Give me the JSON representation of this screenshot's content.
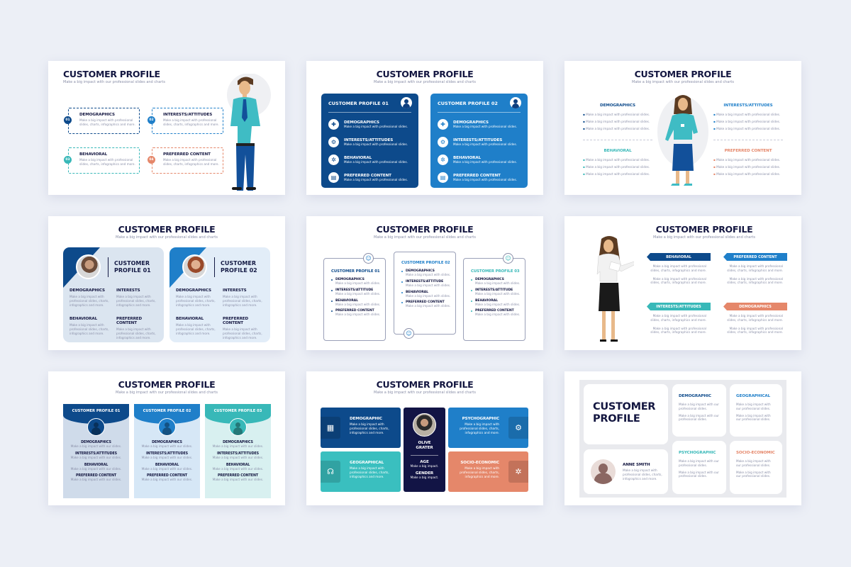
{
  "common": {
    "title": "CUSTOMER PROFILE",
    "subtitle": "Make a big impact with our professional slides and charts"
  },
  "colors": {
    "navy": "#0d4a8b",
    "blue": "#1f7fc9",
    "teal": "#38b8b8",
    "coral": "#e5876a",
    "dark": "#141a44",
    "background": "#eceff6"
  },
  "slide1": {
    "items": [
      {
        "num": "01",
        "heading": "DEMOGRAPHICS",
        "text": "Make a big impact with professional slides, charts, infographics and more."
      },
      {
        "num": "02",
        "heading": "INTERESTS/ATTITUDES",
        "text": "Make a big impact with professional slides, charts, infographics and more."
      },
      {
        "num": "03",
        "heading": "BEHAVIORAL",
        "text": "Make a big impact with professional slides, charts, infographics and more."
      },
      {
        "num": "04",
        "heading": "PREFERRED CONTENT",
        "text": "Make a big impact with professional slides, charts, infographics and more."
      }
    ]
  },
  "slide2": {
    "cards": [
      {
        "title": "CUSTOMER PROFILE 01",
        "rows": [
          {
            "heading": "DEMOGRAPHICS",
            "text": "Make a big impact with professional slides."
          },
          {
            "heading": "INTERESTS/ATTITUDES",
            "text": "Make a big impact with professional slides."
          },
          {
            "heading": "BEHAVIORAL",
            "text": "Make a big impact with professional slides."
          },
          {
            "heading": "PREFERRED CONTENT",
            "text": "Make a big impact with professional slides."
          }
        ]
      },
      {
        "title": "CUSTOMER PROFILE 02",
        "rows": [
          {
            "heading": "DEMOGRAPHICS",
            "text": "Make a big impact with professional slides."
          },
          {
            "heading": "INTERESTS/ATTITUDES",
            "text": "Make a big impact with professional slides."
          },
          {
            "heading": "BEHAVIORAL",
            "text": "Make a big impact with professional slides."
          },
          {
            "heading": "PREFERRED CONTENT",
            "text": "Make a big impact with professional slides."
          }
        ]
      }
    ]
  },
  "slide3": {
    "sections": [
      {
        "heading": "DEMOGRAPHICS",
        "bullets": [
          "Make a big impact with professional slides.",
          "Make a big impact with professional slides.",
          "Make a big impact with professional slides."
        ]
      },
      {
        "heading": "INTERESTS/ATTITUDES",
        "bullets": [
          "Make a big impact with professional slides.",
          "Make a big impact with professional slides.",
          "Make a big impact with professional slides."
        ]
      },
      {
        "heading": "BEHAVIORAL",
        "bullets": [
          "Make a big impact with professional slides.",
          "Make a big impact with professional slides.",
          "Make a big impact with professional slides."
        ]
      },
      {
        "heading": "PREFERRED CONTENT",
        "bullets": [
          "Make a big impact with professional slides.",
          "Make a big impact with professional slides.",
          "Make a big impact with professional slides."
        ]
      }
    ]
  },
  "slide4": {
    "cards": [
      {
        "title_line1": "CUSTOMER",
        "title_line2": "PROFILE 01",
        "cells": [
          {
            "heading": "DEMOGRAPHICS",
            "text": "Make a big impact with professional slides, charts, infographics and more."
          },
          {
            "heading": "INTERESTS",
            "text": "Make a big impact with professional slides, charts, infographics and more."
          },
          {
            "heading": "BEHAVIORAL",
            "text": "Make a big impact with professional slides, charts, infographics and more."
          },
          {
            "heading": "PREFERRED CONTENT",
            "text": "Make a big impact with professional slides, charts, infographics and more."
          }
        ]
      },
      {
        "title_line1": "CUSTOMER",
        "title_line2": "PROFILE 02",
        "cells": [
          {
            "heading": "DEMOGRAPHICS",
            "text": "Make a big impact with professional slides, charts, infographics and more."
          },
          {
            "heading": "INTERESTS",
            "text": "Make a big impact with professional slides, charts, infographics and more."
          },
          {
            "heading": "BEHAVIORAL",
            "text": "Make a big impact with professional slides, charts, infographics and more."
          },
          {
            "heading": "PREFERRED CONTENT",
            "text": "Make a big impact with professional slides, charts, infographics and more."
          }
        ]
      }
    ]
  },
  "slide5": {
    "cards": [
      {
        "title": "CUSTOMER PROFILE 01",
        "items": [
          {
            "heading": "DEMOGRAPHICS",
            "text": "Make a big impact with slides."
          },
          {
            "heading": "INTERESTS/ATTITUDE",
            "text": "Make a big impact with slides."
          },
          {
            "heading": "BEHAVIORAL",
            "text": "Make a big impact with slides."
          },
          {
            "heading": "PREFERRED CONTENT",
            "text": "Make a big impact with slides."
          }
        ]
      },
      {
        "title": "CUSTOMER PROFILE 02",
        "items": [
          {
            "heading": "DEMOGRAPHICS",
            "text": "Make a big impact with slides."
          },
          {
            "heading": "INTERESTS/ATTITUDE",
            "text": "Make a big impact with slides."
          },
          {
            "heading": "BEHAVIORAL",
            "text": "Make a big impact with slides."
          },
          {
            "heading": "PREFERRED CONTENT",
            "text": "Make a big impact with slides."
          }
        ]
      },
      {
        "title": "CUSTOMER PROFILE 03",
        "items": [
          {
            "heading": "DEMOGRAPHICS",
            "text": "Make a big impact with slides."
          },
          {
            "heading": "INTERESTS/ATTITUDE",
            "text": "Make a big impact with slides."
          },
          {
            "heading": "BEHAVIORAL",
            "text": "Make a big impact with slides."
          },
          {
            "heading": "PREFERRED CONTENT",
            "text": "Make a big impact with slides."
          }
        ]
      }
    ]
  },
  "slide6": {
    "sections": [
      {
        "heading": "BEHAVIORAL",
        "paras": [
          "Make a big impact with professional slides, charts, infographics and more.",
          "Make a big impact with professional slides, charts, infographics and more."
        ]
      },
      {
        "heading": "PREFERRED CONTENT",
        "paras": [
          "Make a big impact with professional slides, charts, infographics and more.",
          "Make a big impact with professional slides, charts, infographics and more."
        ]
      },
      {
        "heading": "INTERESTS/ATTITUDES",
        "paras": [
          "Make a big impact with professional slides, charts, infographics and more.",
          "Make a big impact with professional slides, charts, infographics and more."
        ]
      },
      {
        "heading": "DEMOGRAPHICS",
        "paras": [
          "Make a big impact with professional slides, charts, infographics and more.",
          "Make a big impact with professional slides, charts, infographics and more."
        ]
      }
    ]
  },
  "slide7": {
    "columns": [
      {
        "title": "CUSTOMER PROFILE 01",
        "items": [
          {
            "heading": "DEMOGRAPHICS",
            "text": "Make a big impact with our slides."
          },
          {
            "heading": "INTERESTS/ATTITUDES",
            "text": "Make a big impact with our slides."
          },
          {
            "heading": "BEHAVIORAL",
            "text": "Make a big impact with our slides."
          },
          {
            "heading": "PREFERRED CONTENT",
            "text": "Make a big impact with our slides."
          }
        ]
      },
      {
        "title": "CUSTOMER PROFILE 02",
        "items": [
          {
            "heading": "DEMOGRAPHICS",
            "text": "Make a big impact with our slides."
          },
          {
            "heading": "INTERESTS/ATTITUDES",
            "text": "Make a big impact with our slides."
          },
          {
            "heading": "BEHAVIORAL",
            "text": "Make a big impact with our slides."
          },
          {
            "heading": "PREFERRED CONTENT",
            "text": "Make a big impact with our slides."
          }
        ]
      },
      {
        "title": "CUSTOMER PROFILE 03",
        "items": [
          {
            "heading": "DEMOGRAPHICS",
            "text": "Make a big impact with our slides."
          },
          {
            "heading": "INTERESTS/ATTITUDES",
            "text": "Make a big impact with our slides."
          },
          {
            "heading": "BEHAVIORAL",
            "text": "Make a big impact with our slides."
          },
          {
            "heading": "PREFERRED CONTENT",
            "text": "Make a big impact with our slides."
          }
        ]
      }
    ]
  },
  "slide8": {
    "demographic": {
      "heading": "DEMOGRAPHIC",
      "text": "Make a big impact with professional slides, charts, infographics and more.",
      "icon": "document-chart-icon"
    },
    "geographical": {
      "heading": "GEOGRAPHICAL",
      "text": "Make a big impact with professional slides, charts, infographics and more.",
      "icon": "head-idea-icon"
    },
    "psychographic": {
      "heading": "PSYCHOGRAPHIC",
      "text": "Make a big impact with professional slides, charts, infographics and more.",
      "icon": "workflow-icon"
    },
    "socio": {
      "heading": "SOCIO-ECONOMIC",
      "text": "Make a big impact with professional slides, charts, infographics and more.",
      "icon": "gears-icon"
    },
    "person": {
      "name_line1": "OLIVE",
      "name_line2": "GRATER",
      "age_label": "AGE",
      "age_text": "Make a big impact.",
      "gender_label": "GENDER",
      "gender_text": "Make a big impact."
    }
  },
  "slide9": {
    "title_line1": "CUSTOMER",
    "title_line2": "PROFILE",
    "person": {
      "name": "ANNE SMITH",
      "text": "Make a big impact with professional slides, charts, infographics and more."
    },
    "cells": [
      {
        "heading": "DEMOGRAPHIC",
        "p1": "Make a big impact with our professional slides.",
        "p2": "Make a big impact with our professional slides."
      },
      {
        "heading": "GEOGRAPHICAL",
        "p1": "Make a big impact with our professional slides.",
        "p2": "Make a big impact with our professional slides."
      },
      {
        "heading": "PSYCHOGRAPHIC",
        "p1": "Make a big impact with our professional slides.",
        "p2": "Make a big impact with our professional slides."
      },
      {
        "heading": "SOCIO-ECONOMIC",
        "p1": "Make a big impact with our professional slides.",
        "p2": "Make a big impact with our professional slides."
      }
    ]
  }
}
